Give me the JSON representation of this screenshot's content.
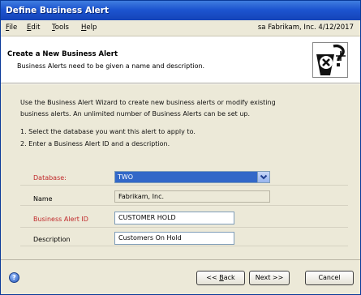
{
  "window": {
    "title": "Define Business Alert"
  },
  "menubar": {
    "items": [
      {
        "accel": "F",
        "rest": "ile"
      },
      {
        "accel": "E",
        "rest": "dit"
      },
      {
        "accel": "T",
        "rest": "ools"
      },
      {
        "accel": "H",
        "rest": "elp"
      }
    ],
    "status": "sa  Fabrikam, Inc.  4/12/2017"
  },
  "header": {
    "title": "Create a New Business Alert",
    "subtitle": "Business Alerts need to be given a name and description."
  },
  "intro": {
    "line1": "Use the Business Alert Wizard to create new business alerts or modify existing",
    "line2": "business alerts. An unlimited number of Business Alerts can be set up."
  },
  "steps": {
    "step1": "1. Select the database you want this alert to apply to.",
    "step2": "2. Enter a Business Alert ID and a description."
  },
  "form": {
    "database_label": "Database:",
    "database_value": "TWO",
    "name_label": "Name",
    "name_value": "Fabrikam, Inc.",
    "alert_id_label": "Business Alert ID",
    "alert_id_value": "CUSTOMER HOLD",
    "description_label": "Description",
    "description_value": "Customers On Hold"
  },
  "buttons": {
    "back_prefix": "<< ",
    "back_accel": "B",
    "back_rest": "ack",
    "next": "Next >>",
    "cancel": "Cancel"
  },
  "colors": {
    "titlebar": "#1d55d0",
    "required_label": "#c0282a",
    "selected_field": "#3268c8",
    "dialog_bg": "#ece9d8"
  },
  "icons": {
    "header": "alert-wizard-icon",
    "help": "help-icon",
    "dropdown": "chevron-down-icon"
  }
}
